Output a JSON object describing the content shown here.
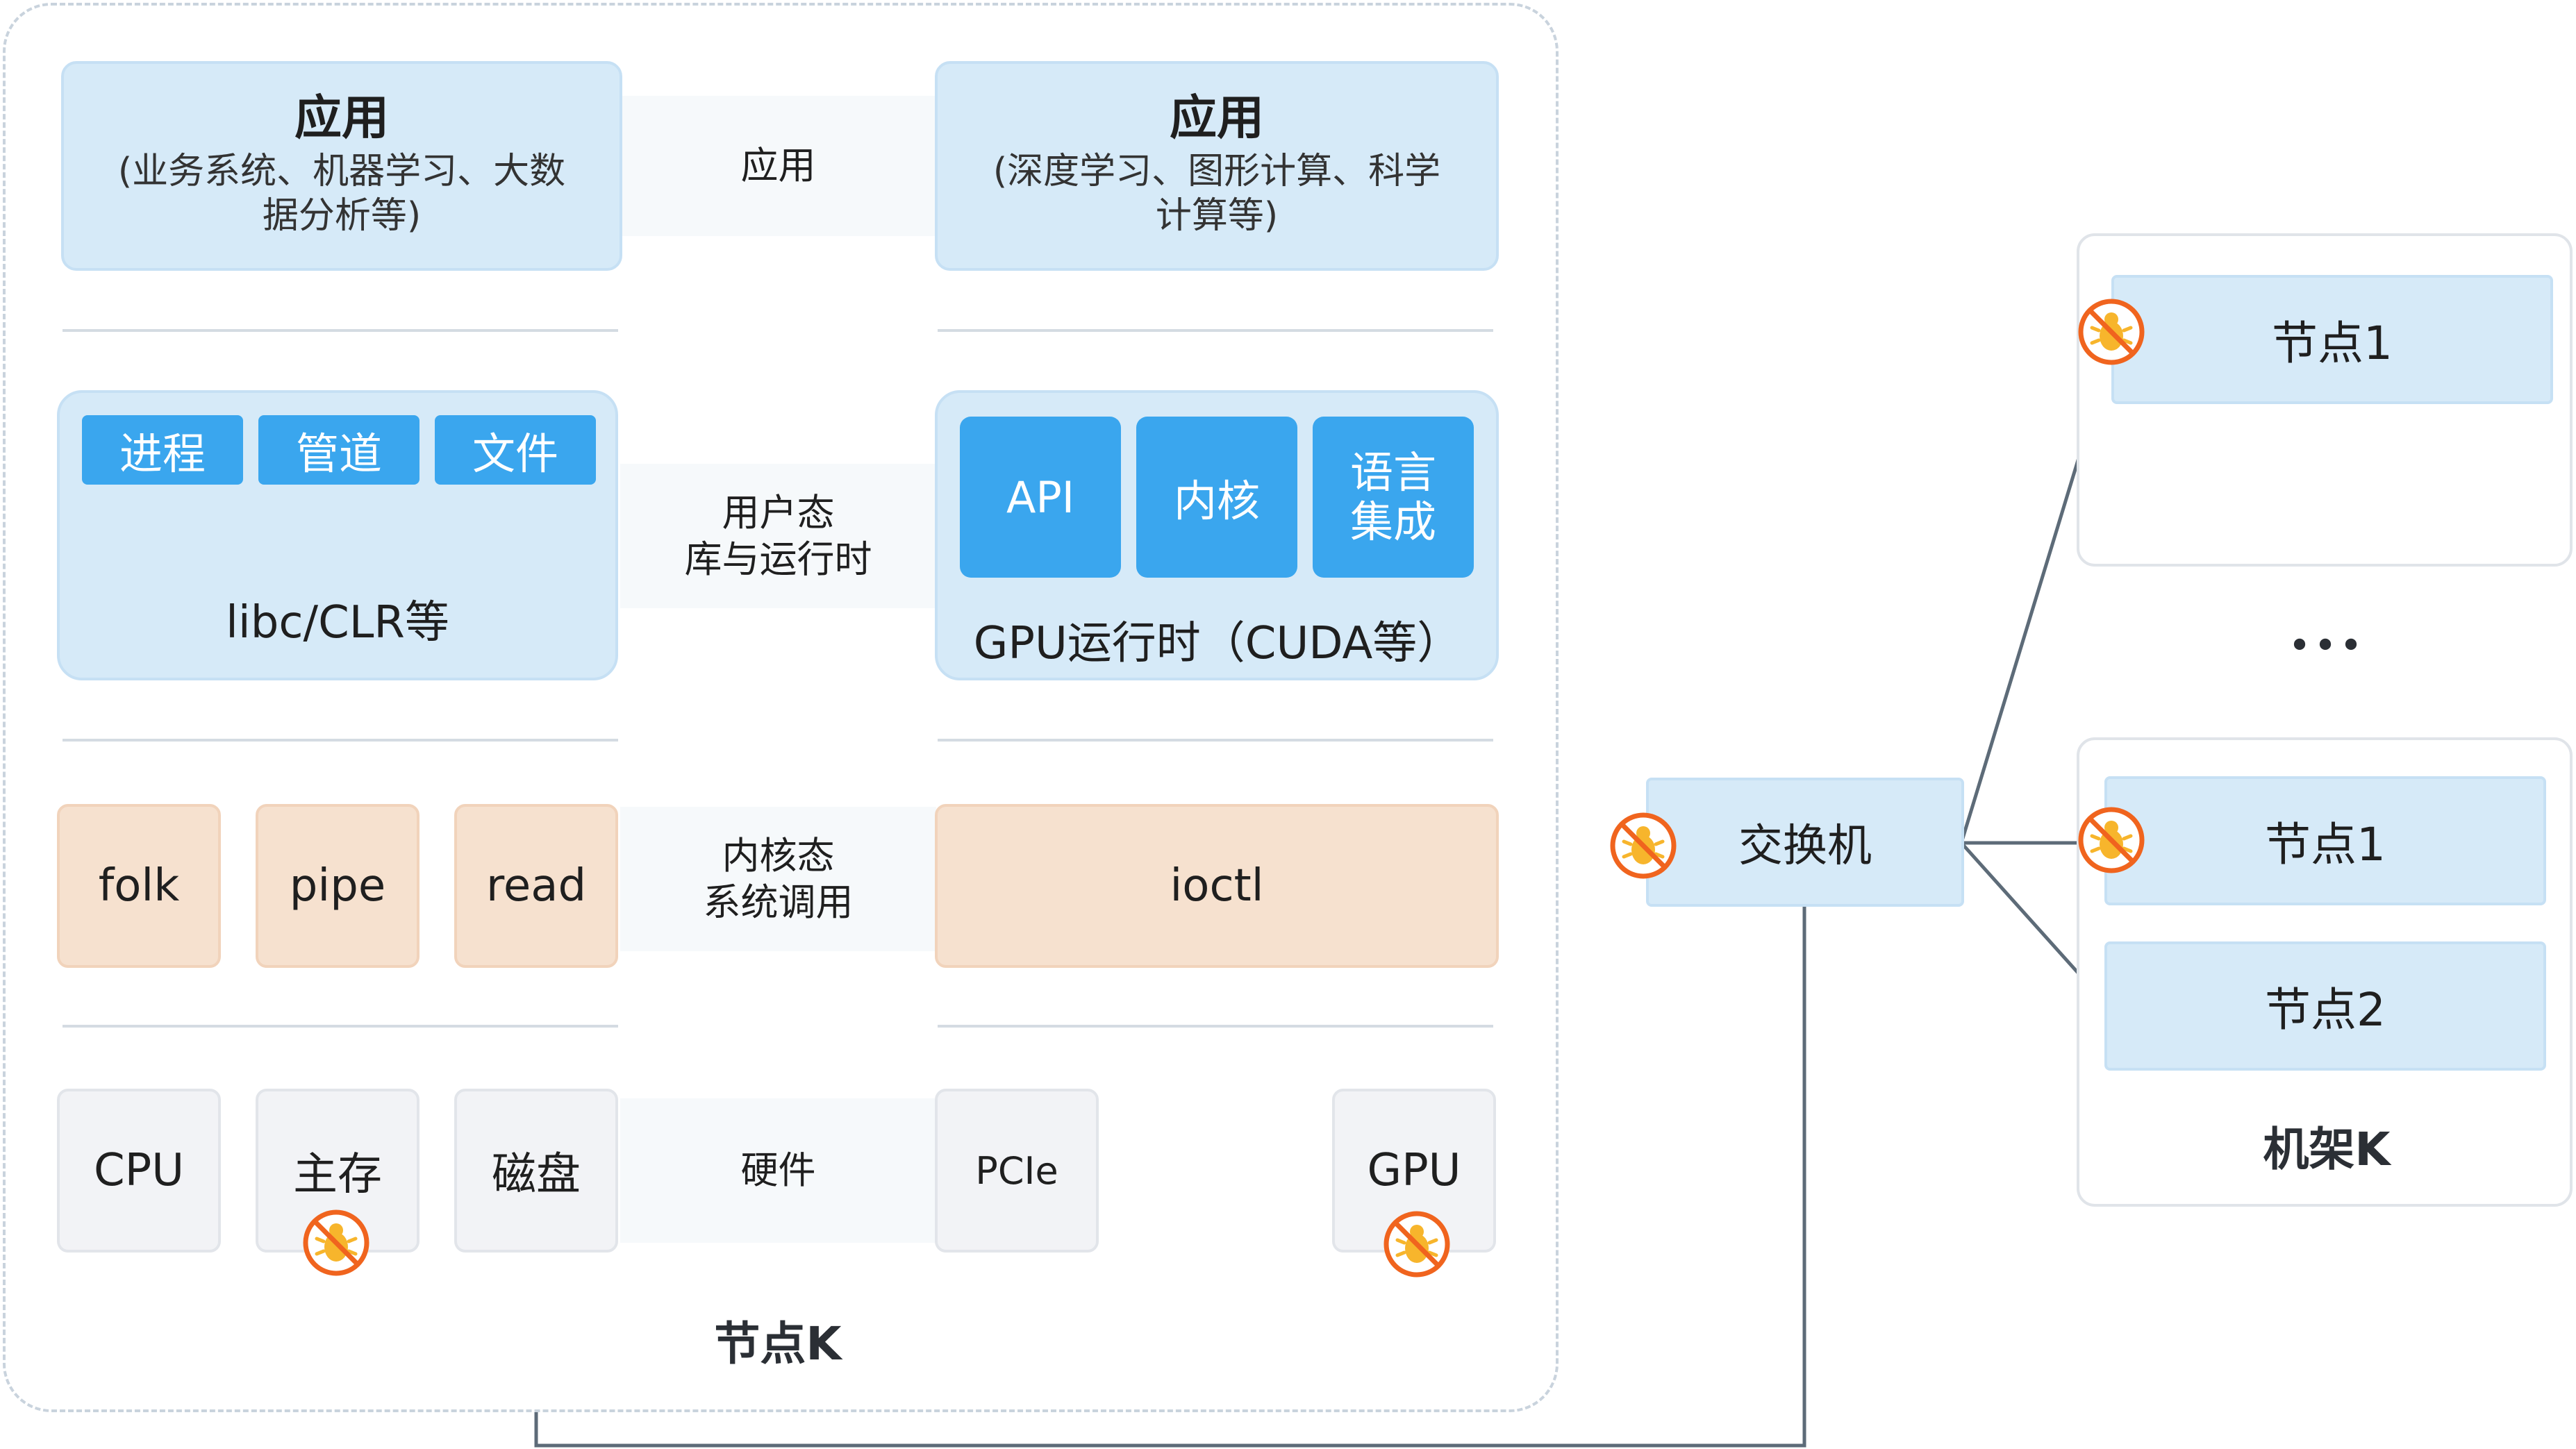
{
  "node": {
    "caption": "节点K",
    "app_layer": {
      "band_label": "应用",
      "left": {
        "title": "应用",
        "subtitle": "(业务系统、机器学习、大数据分析等)"
      },
      "right": {
        "title": "应用",
        "subtitle": "(深度学习、图形计算、科学计算等)"
      }
    },
    "runtime_layer": {
      "band_label_line1": "用户态",
      "band_label_line2": "库与运行时",
      "left_tags": [
        "进程",
        "管道",
        "文件"
      ],
      "left_caption": "libc/CLR等",
      "right_tags": [
        "API",
        "内核",
        "语言集成"
      ],
      "right_caption": "GPU运行时（CUDA等）"
    },
    "kernel_layer": {
      "band_label_line1": "内核态",
      "band_label_line2": "系统调用",
      "calls_left": [
        "folk",
        "pipe",
        "read"
      ],
      "call_right": "ioctl"
    },
    "hardware_layer": {
      "band_label": "硬件",
      "items": [
        "CPU",
        "主存",
        "磁盘",
        "PCIe",
        "GPU"
      ]
    }
  },
  "switch": {
    "label": "交换机"
  },
  "rack": {
    "caption": "机架K",
    "ellipsis": "•••",
    "top_node": "节点1",
    "bottom_nodes": [
      "节点1",
      "节点2"
    ]
  },
  "colors": {
    "accent_blue": "#3aa6ee",
    "light_blue": "#d6eaf8",
    "peach": "#f6e1cf",
    "fault_orange": "#f0641e",
    "fault_yellow": "#f7b52c",
    "connector": "#5d6b78"
  },
  "icons": {
    "fault": "bug-prohibited-icon"
  }
}
